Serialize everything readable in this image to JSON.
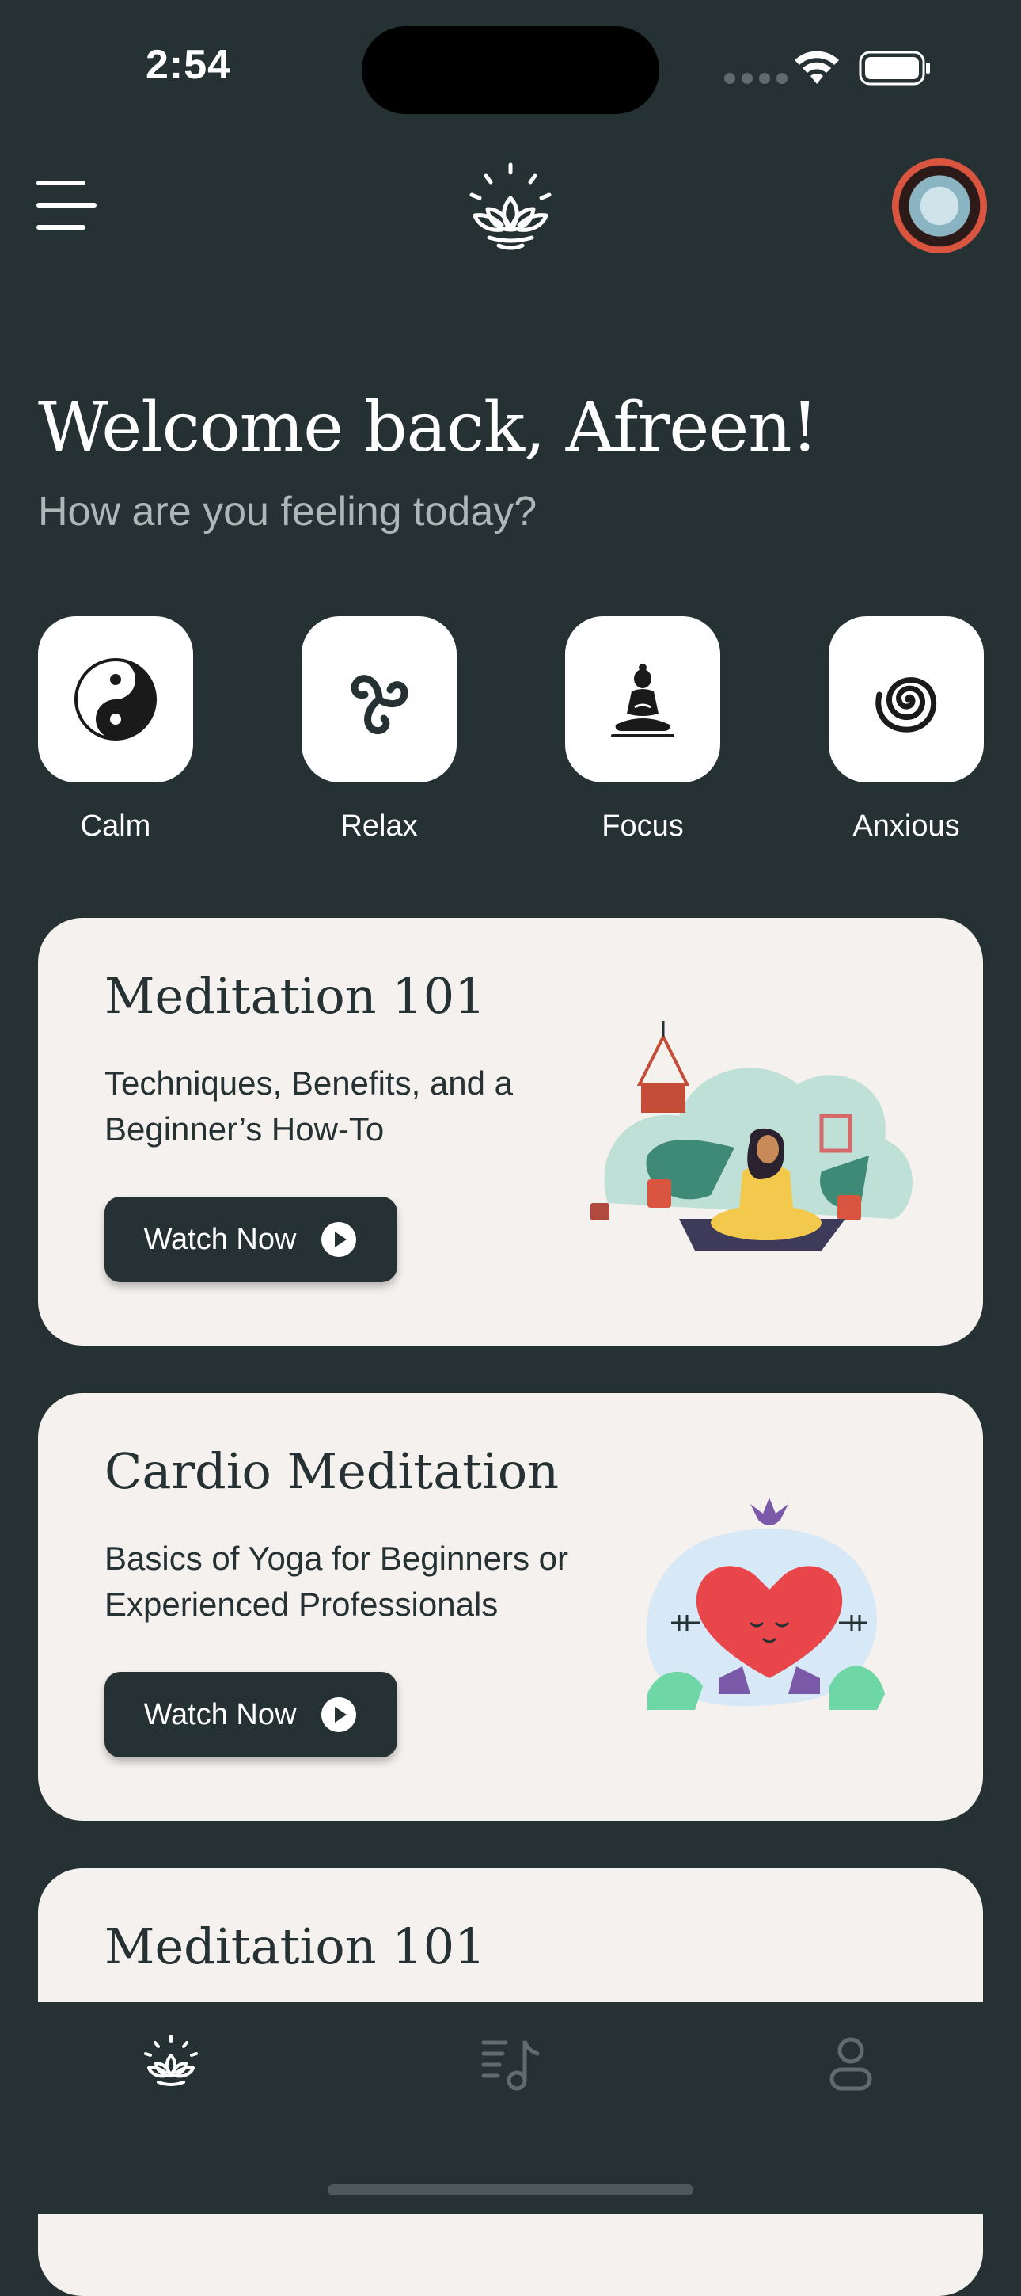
{
  "status_bar": {
    "time": "2:54"
  },
  "header": {
    "menu_icon": "hamburger-menu-icon",
    "logo_icon": "lotus-logo-icon",
    "avatar_icon": "user-avatar"
  },
  "welcome": {
    "title": "Welcome back, Afreen!",
    "subtitle": "How are you feeling today?"
  },
  "moods": [
    {
      "label": "Calm",
      "icon": "yin-yang-icon"
    },
    {
      "label": "Relax",
      "icon": "triskelion-icon"
    },
    {
      "label": "Focus",
      "icon": "buddha-icon"
    },
    {
      "label": "Anxious",
      "icon": "spiral-icon"
    }
  ],
  "cards": [
    {
      "title": "Meditation 101",
      "description": "Techniques, Benefits, and a Beginner’s How-To",
      "button": "Watch Now",
      "illustration": "woman-meditating-illustration"
    },
    {
      "title": "Cardio Meditation",
      "description": "Basics of Yoga for Beginners or Experienced Professionals",
      "button": "Watch Now",
      "illustration": "heart-meditating-illustration"
    },
    {
      "title": "Meditation 101",
      "description": "",
      "button": "",
      "illustration": "woman-meditating-illustration"
    }
  ],
  "bottom_nav": [
    {
      "icon": "lotus-home-icon",
      "active": true
    },
    {
      "icon": "music-playlist-icon",
      "active": false
    },
    {
      "icon": "profile-icon",
      "active": false
    }
  ],
  "colors": {
    "background": "#253133",
    "card": "#f5f1ee",
    "muted_text": "#aeb7b8",
    "inactive_icon": "#5f6b6d"
  }
}
